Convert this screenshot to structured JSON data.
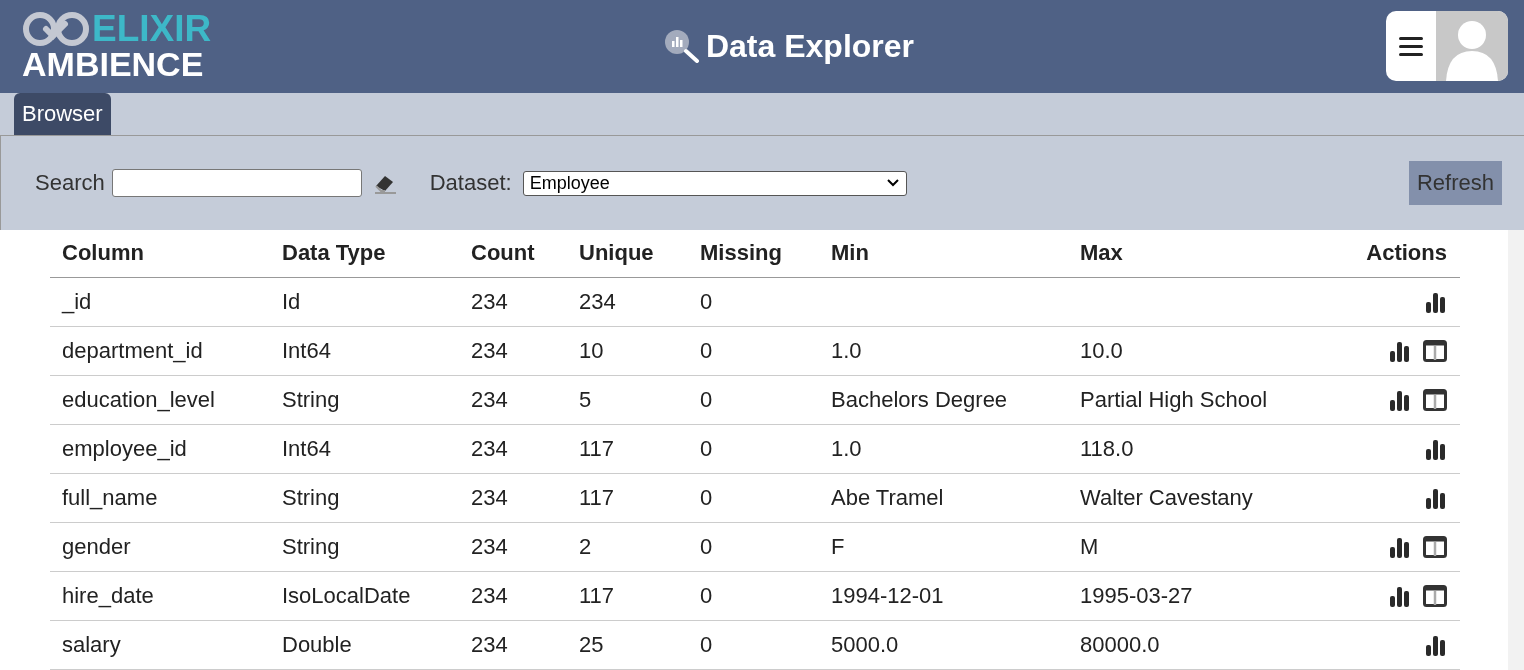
{
  "header": {
    "logo_top": "ELIXIR",
    "logo_bottom": "AMBIENCE",
    "title": "Data Explorer"
  },
  "tabs": [
    {
      "label": "Browser",
      "selected": true
    }
  ],
  "toolbar": {
    "search_label": "Search",
    "dataset_label": "Dataset:",
    "dataset_value": "Employee",
    "refresh": "Refresh"
  },
  "table": {
    "columns": [
      "Column",
      "Data Type",
      "Count",
      "Unique",
      "Missing",
      "Min",
      "Max",
      "Actions"
    ],
    "rows": [
      {
        "cells": [
          "_id",
          "Id",
          "234",
          "234",
          "0",
          "",
          ""
        ],
        "table_view": false
      },
      {
        "cells": [
          "department_id",
          "Int64",
          "234",
          "10",
          "0",
          "1.0",
          "10.0"
        ],
        "table_view": true
      },
      {
        "cells": [
          "education_level",
          "String",
          "234",
          "5",
          "0",
          "Bachelors Degree",
          "Partial High School"
        ],
        "table_view": true
      },
      {
        "cells": [
          "employee_id",
          "Int64",
          "234",
          "117",
          "0",
          "1.0",
          "118.0"
        ],
        "table_view": false
      },
      {
        "cells": [
          "full_name",
          "String",
          "234",
          "117",
          "0",
          "Abe Tramel",
          "Walter Cavestany"
        ],
        "table_view": false
      },
      {
        "cells": [
          "gender",
          "String",
          "234",
          "2",
          "0",
          "F",
          "M"
        ],
        "table_view": true
      },
      {
        "cells": [
          "hire_date",
          "IsoLocalDate",
          "234",
          "117",
          "0",
          "1994-12-01",
          "1995-03-27"
        ],
        "table_view": true
      },
      {
        "cells": [
          "salary",
          "Double",
          "234",
          "25",
          "0",
          "5000.0",
          "80000.0"
        ],
        "table_view": false
      }
    ]
  }
}
